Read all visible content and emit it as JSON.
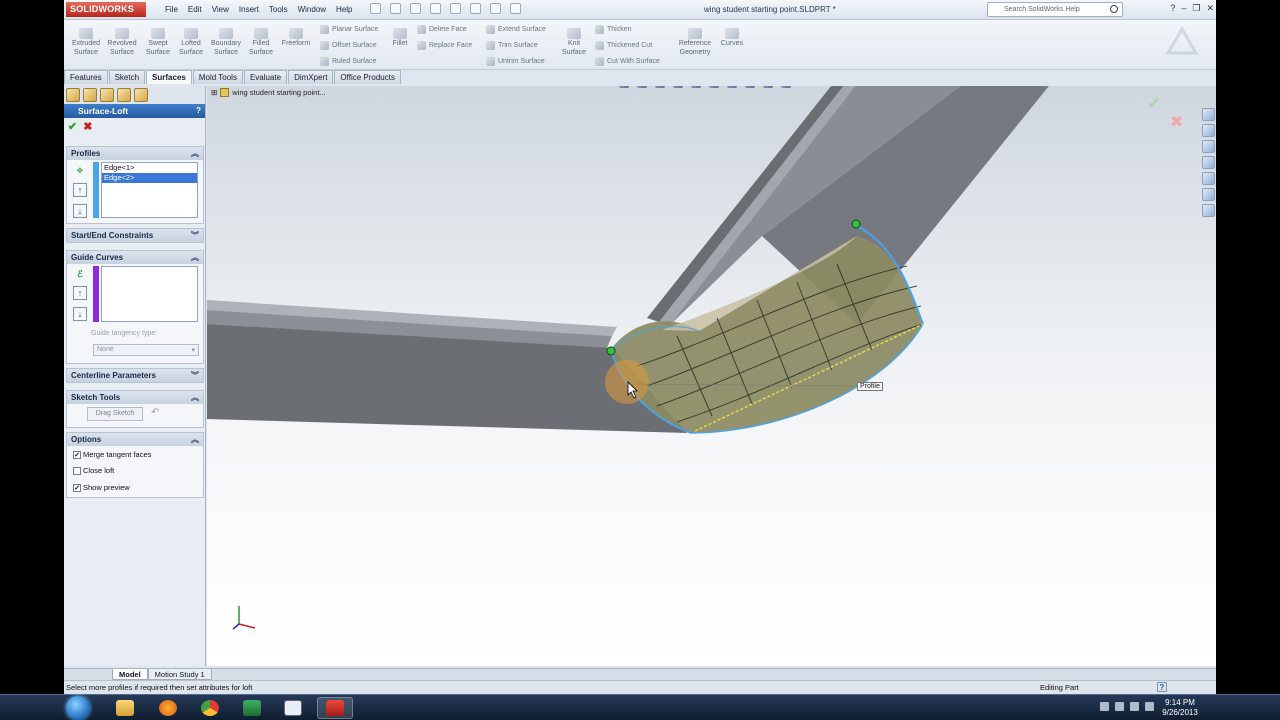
{
  "app": {
    "logo_text": "SOLIDWORKS",
    "document_title": "wing student starting point.SLDPRT *",
    "menus": [
      "File",
      "Edit",
      "View",
      "Insert",
      "Tools",
      "Window",
      "Help"
    ],
    "search_placeholder": "Search SolidWorks Help"
  },
  "command_manager": {
    "large_tools": [
      {
        "label": "Extruded\nSurface"
      },
      {
        "label": "Revolved\nSurface"
      },
      {
        "label": "Swept\nSurface"
      },
      {
        "label": "Lofted\nSurface"
      },
      {
        "label": "Boundary\nSurface"
      },
      {
        "label": "Filled\nSurface"
      },
      {
        "label": "Freeform"
      }
    ],
    "col1": [
      "Planar Surface",
      "Offset Surface",
      "Ruled Surface"
    ],
    "fillet": "Fillet",
    "col2": [
      "Delete Face",
      "Replace Face"
    ],
    "col3": [
      "Extend Surface",
      "Trim Surface",
      "Untrim Surface"
    ],
    "knit": "Knit\nSurface",
    "col4": [
      "Thicken",
      "Thickened Cut",
      "Cut With Surface"
    ],
    "ref_geometry": "Reference\nGeometry",
    "curves": "Curves"
  },
  "tabs": [
    "Features",
    "Sketch",
    "Surfaces",
    "Mold Tools",
    "Evaluate",
    "DimXpert",
    "Office Products"
  ],
  "active_tab": "Surfaces",
  "property_manager": {
    "title": "Surface-Loft",
    "help": "?",
    "profiles": {
      "header": "Profiles",
      "items": [
        "Edge<1>",
        "Edge<2>"
      ],
      "selected_index": 1
    },
    "start_end": {
      "header": "Start/End Constraints"
    },
    "guide_curves": {
      "header": "Guide Curves",
      "tangency_label": "Guide tangency type:",
      "tangency_value": "None"
    },
    "centerline": {
      "header": "Centerline Parameters"
    },
    "sketch_tools": {
      "header": "Sketch Tools",
      "drag_sketch": "Drag Sketch"
    },
    "options": {
      "header": "Options",
      "items": [
        {
          "label": "Merge tangent faces",
          "checked": true
        },
        {
          "label": "Close loft",
          "checked": false
        },
        {
          "label": "Show preview",
          "checked": true
        }
      ]
    }
  },
  "viewport": {
    "tree_item": "wing student starting point...",
    "callout": "Profile"
  },
  "bottom_tabs": [
    "Model",
    "Motion Study 1"
  ],
  "status": {
    "message": "Select more profiles if required then set attributes for loft",
    "mode": "Editing Part",
    "help": "?"
  },
  "taskbar": {
    "time": "9:14 PM",
    "date": "9/26/2013"
  },
  "colors": {
    "accent": "#3a77d6",
    "loft_preview": "#8b8a62",
    "profile_edge": "#4aa3e8",
    "guide_bar": "#8a2be2",
    "ok": "#2aa02a",
    "cancel": "#c8201a"
  }
}
